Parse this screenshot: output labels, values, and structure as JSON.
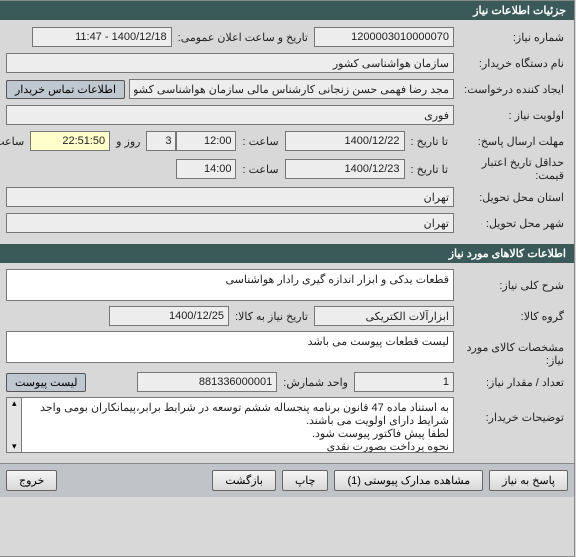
{
  "header1": "جزئیات اطلاعات نیاز",
  "header2": "اطلاعات کالاهای مورد نیاز",
  "labels": {
    "need_no": "شماره نیاز:",
    "announce_dt": "تاریخ و ساعت اعلان عمومی:",
    "buyer": "نام دستگاه خریدار:",
    "requester": "ایجاد کننده درخواست:",
    "priority": "اولویت نیاز :",
    "reply_deadline": "مهلت ارسال پاسخ:",
    "to_date": "تا تاریخ :",
    "time": "ساعت :",
    "time2": "ساعت :",
    "days_and": "روز و",
    "hours_left": "ساعت باقی مانده",
    "min_valid": "حداقل تاریخ اعتبار قیمت:",
    "to_date2": "تا تاریخ :",
    "province": "استان محل تحویل:",
    "city": "شهر محل تحویل:",
    "desc": "شرح کلی نیاز:",
    "group": "گروه کالا:",
    "need_date": "تاریخ نیاز به کالا:",
    "spec": "مشخصات کالای مورد نیاز:",
    "qty": "تعداد / مقدار نیاز:",
    "unit": "واحد شمارش:",
    "buyer_notes": "توضیحات خریدار:"
  },
  "values": {
    "need_no": "1200003010000070",
    "announce_dt": "1400/12/18 - 11:47",
    "buyer": "سازمان هواشناسی کشور",
    "requester": "مجد رضا فهمی حسن زنجانی کارشناس مالی سازمان هواشناسی کشور",
    "priority": "فوری",
    "reply_to_date": "1400/12/22",
    "reply_time": "12:00",
    "days_left": "3",
    "hours_left": "22:51:50",
    "valid_to_date": "1400/12/23",
    "valid_time": "14:00",
    "province": "تهران",
    "city": "تهران",
    "desc": "قطعات یدکی و ابزار اندازه گیری رادار هواشناسی",
    "group": "ابزارآلات الکتریکی",
    "need_date": "1400/12/25",
    "spec": "لیست قطعات پیوست می باشد",
    "qty": "1",
    "unit": "881336000001",
    "notes": "به استناد ماده 47 قانون برنامه پنجساله ششم توسعه در شرایط برابر،پیمانکاران بومی واجد شرایط دارای اولویت می باشند.\nلطفا پیش فاکتور پیوست شود.\nنحوه پرداخت بصورت نقدی"
  },
  "buttons": {
    "contact": "اطلاعات تماس خریدار",
    "attach_list": "لیست پیوست",
    "reply": "پاسخ به نیاز",
    "view_attach": "مشاهده مدارک پیوستی (1)",
    "print": "چاپ",
    "back": "بازگشت",
    "exit": "خروج"
  }
}
